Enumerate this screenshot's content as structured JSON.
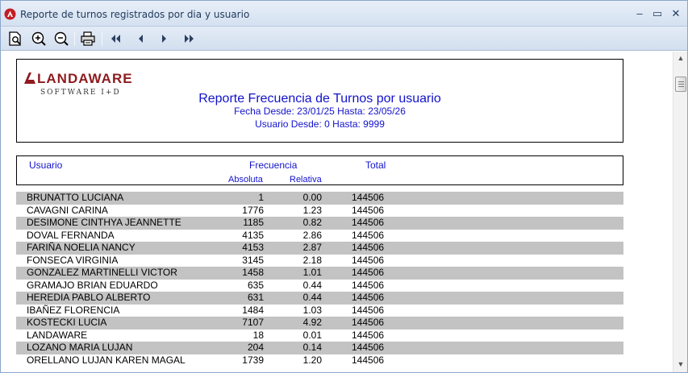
{
  "window": {
    "title": "Reporte de turnos registrados por dia y usuario",
    "controls": {
      "minimize": "–",
      "maximize": "▭",
      "close": "✕"
    }
  },
  "toolbar": {
    "buttons": [
      "page-preview",
      "zoom-in",
      "zoom-out",
      "print",
      "first-page",
      "previous-page",
      "next-page",
      "last-page"
    ]
  },
  "report": {
    "logo_main": "LANDAWARE",
    "logo_sub": "SOFTWARE I+D",
    "title": "Reporte Frecuencia de Turnos por usuario",
    "date_range": "Fecha Desde: 23/01/25 Hasta: 23/05/26",
    "user_range": "Usuario Desde: 0 Hasta: 9999",
    "columns": {
      "usuario": "Usuario",
      "frecuencia": "Frecuencia",
      "total": "Total",
      "absoluta": "Absoluta",
      "relativa": "Relativa"
    },
    "rows": [
      {
        "usuario": "BRUNATTO LUCIANA",
        "absoluta": "1",
        "relativa": "0.00",
        "total": "144506"
      },
      {
        "usuario": "CAVAGNI CARINA",
        "absoluta": "1776",
        "relativa": "1.23",
        "total": "144506"
      },
      {
        "usuario": "DESIMONE CINTHYA JEANNETTE",
        "absoluta": "1185",
        "relativa": "0.82",
        "total": "144506"
      },
      {
        "usuario": "DOVAL FERNANDA",
        "absoluta": "4135",
        "relativa": "2.86",
        "total": "144506"
      },
      {
        "usuario": "FARIÑA NOELIA NANCY",
        "absoluta": "4153",
        "relativa": "2.87",
        "total": "144506"
      },
      {
        "usuario": "FONSECA VIRGINIA",
        "absoluta": "3145",
        "relativa": "2.18",
        "total": "144506"
      },
      {
        "usuario": "GONZALEZ MARTINELLI VICTOR",
        "absoluta": "1458",
        "relativa": "1.01",
        "total": "144506"
      },
      {
        "usuario": "GRAMAJO BRIAN EDUARDO",
        "absoluta": "635",
        "relativa": "0.44",
        "total": "144506"
      },
      {
        "usuario": "HEREDIA PABLO ALBERTO",
        "absoluta": "631",
        "relativa": "0.44",
        "total": "144506"
      },
      {
        "usuario": "IBAÑEZ FLORENCIA",
        "absoluta": "1484",
        "relativa": "1.03",
        "total": "144506"
      },
      {
        "usuario": "KOSTECKI LUCIA",
        "absoluta": "7107",
        "relativa": "4.92",
        "total": "144506"
      },
      {
        "usuario": "LANDAWARE",
        "absoluta": "18",
        "relativa": "0.01",
        "total": "144506"
      },
      {
        "usuario": "LOZANO MARIA LUJAN",
        "absoluta": "204",
        "relativa": "0.14",
        "total": "144506"
      },
      {
        "usuario": "ORELLANO LUJAN KAREN MAGAL",
        "absoluta": "1739",
        "relativa": "1.20",
        "total": "144506"
      }
    ]
  },
  "colors": {
    "report_blue": "#1212cc",
    "row_shade": "#c3c3c3",
    "logo_red": "#8e1b1f"
  }
}
